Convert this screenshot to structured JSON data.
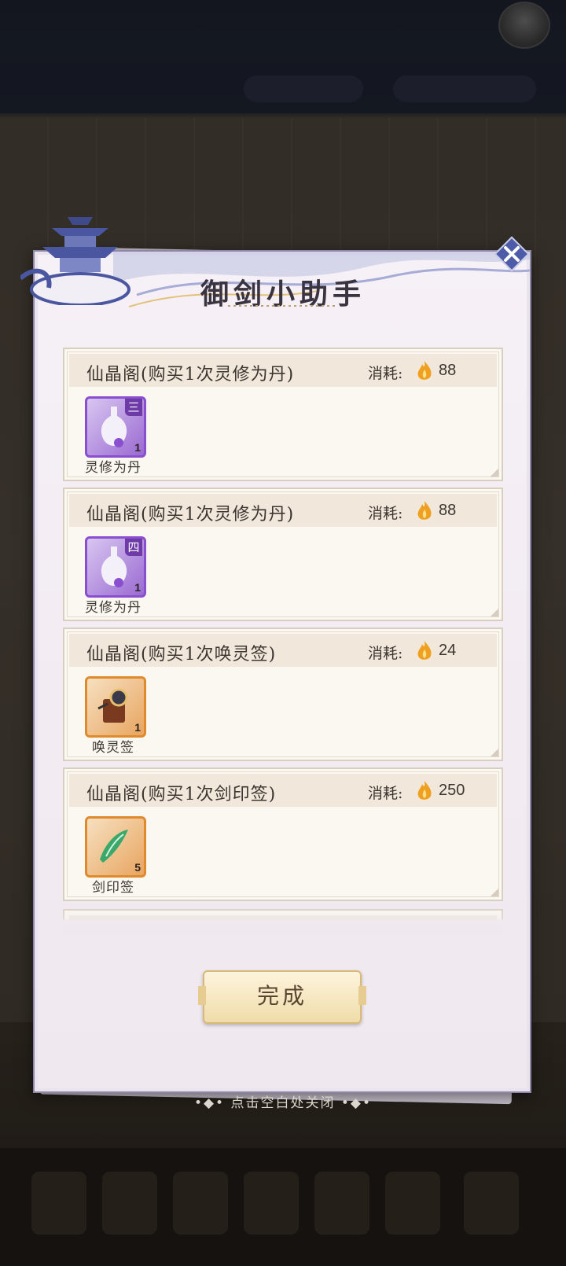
{
  "dialog": {
    "title": "御剑小助手",
    "cost_label": "消耗:",
    "done_label": "完成",
    "dismiss_hint": "•◆• 点击空白处关闭 •◆•"
  },
  "tasks": [
    {
      "title": "仙晶阁(购买1次灵修为丹)",
      "cost": "88",
      "item": {
        "name": "灵修为丹",
        "grade": "三",
        "count": "1",
        "rarity": "purple"
      }
    },
    {
      "title": "仙晶阁(购买1次灵修为丹)",
      "cost": "88",
      "item": {
        "name": "灵修为丹",
        "grade": "四",
        "count": "1",
        "rarity": "purple"
      }
    },
    {
      "title": "仙晶阁(购买1次唤灵签)",
      "cost": "24",
      "item": {
        "name": "唤灵签",
        "grade": "",
        "count": "1",
        "rarity": "orange"
      }
    },
    {
      "title": "仙晶阁(购买1次剑印签)",
      "cost": "250",
      "item": {
        "name": "剑印签",
        "grade": "",
        "count": "5",
        "rarity": "orange"
      }
    }
  ],
  "colors": {
    "purple_border": "#8a4fcf",
    "orange_border": "#e08a2e",
    "flame": "#f0a020"
  },
  "icons": {
    "close": "close-icon",
    "currency": "flame-icon"
  }
}
